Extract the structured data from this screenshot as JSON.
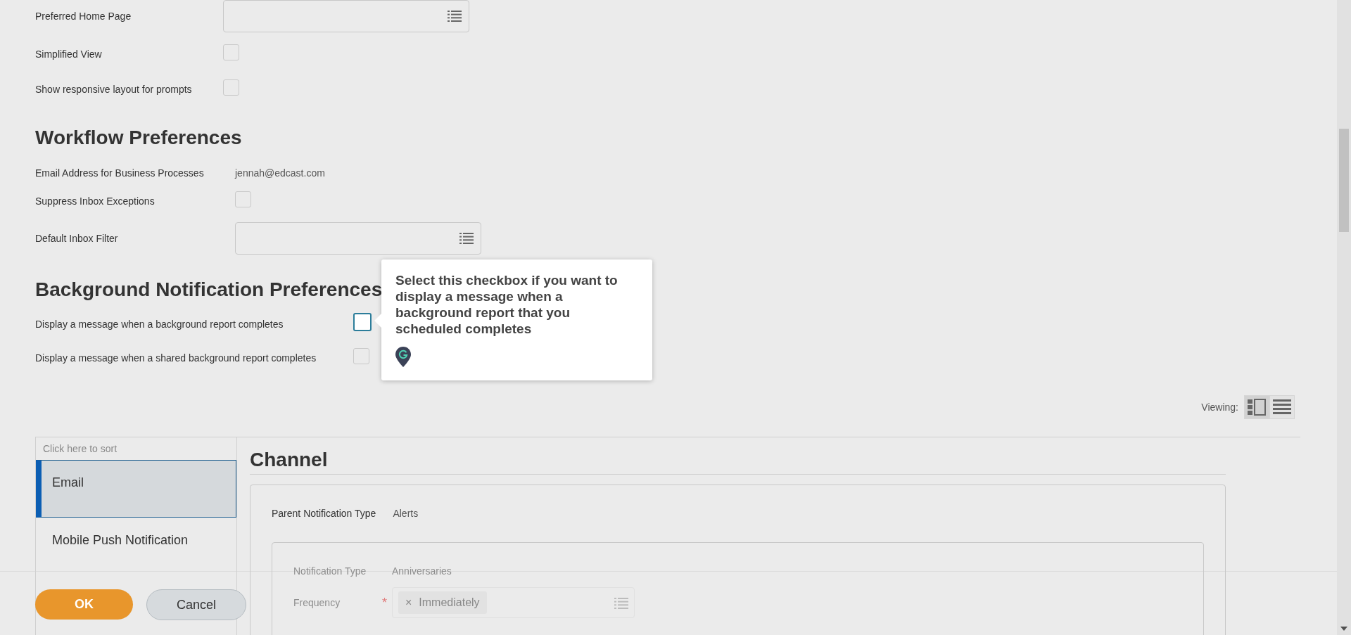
{
  "preferences": [
    {
      "kind": "select",
      "label": "Preferred Home Page"
    },
    {
      "kind": "checkbox",
      "label": "Simplified View",
      "checked": false
    },
    {
      "kind": "checkbox",
      "label": "Show responsive layout for prompts",
      "checked": false
    }
  ],
  "workflow": {
    "title": "Workflow Preferences",
    "fields": [
      {
        "kind": "text",
        "label": "Email Address for Business Processes",
        "value": "jennah@edcast.com"
      },
      {
        "kind": "checkbox",
        "label": "Suppress Inbox Exceptions",
        "checked": false
      },
      {
        "kind": "select",
        "label": "Default Inbox Filter"
      }
    ]
  },
  "background": {
    "title": "Background Notification Preferences",
    "fields": [
      {
        "kind": "checkbox",
        "label": "Display a message when a background report completes",
        "checked": false,
        "tooltip": "Select this checkbox if you want to display a message when a background report that you scheduled completes"
      },
      {
        "kind": "checkbox",
        "label": "Display a message when a shared background report completes",
        "checked": false
      }
    ]
  },
  "viewing": {
    "label": "Viewing:",
    "modes": [
      {
        "kind": "split",
        "selected": true
      },
      {
        "kind": "list",
        "selected": false
      }
    ]
  },
  "channels": {
    "sort_hint": "Click here to sort",
    "items": [
      {
        "label": "Email",
        "selected": true
      },
      {
        "label": "Mobile Push Notification",
        "selected": false
      }
    ]
  },
  "detail": {
    "title": "Channel",
    "parent_label": "Parent Notification Type",
    "parent_value": "Alerts",
    "notification_label": "Notification Type",
    "notification_value": "Anniversaries",
    "frequency_label": "Frequency",
    "required_mark": "*",
    "remove_symbol": "×",
    "frequency_value": "Immediately"
  },
  "footer": {
    "buttons": [
      {
        "kind": "primary",
        "label": "OK"
      },
      {
        "kind": "secondary",
        "label": "Cancel"
      }
    ]
  }
}
